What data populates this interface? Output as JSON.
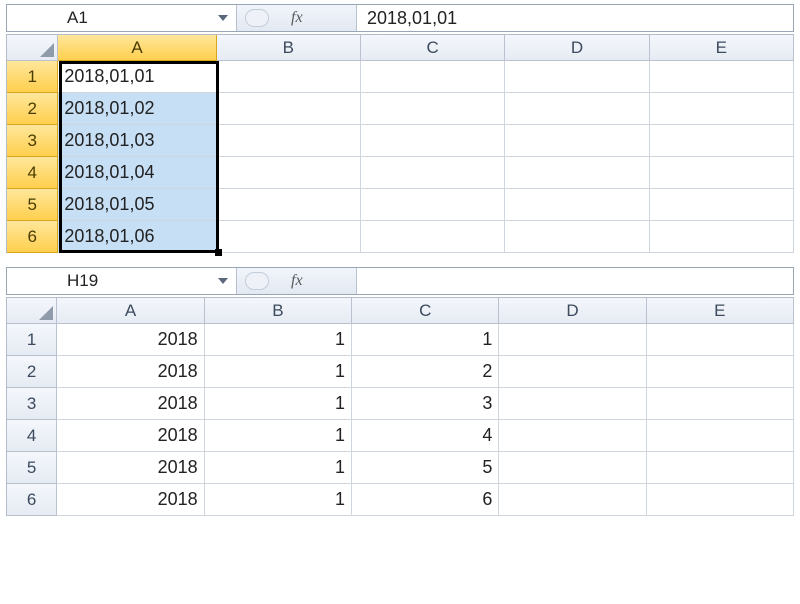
{
  "top_sheet": {
    "namebox": "A1",
    "formula_value": "2018,01,01",
    "columns": [
      "A",
      "B",
      "C",
      "D",
      "E"
    ],
    "row_numbers": [
      "1",
      "2",
      "3",
      "4",
      "5",
      "6"
    ],
    "cells": {
      "A": [
        "2018,01,01",
        "2018,01,02",
        "2018,01,03",
        "2018,01,04",
        "2018,01,05",
        "2018,01,06"
      ],
      "B": [
        "",
        "",
        "",
        "",
        "",
        ""
      ],
      "C": [
        "",
        "",
        "",
        "",
        "",
        ""
      ],
      "D": [
        "",
        "",
        "",
        "",
        "",
        ""
      ],
      "E": [
        "",
        "",
        "",
        "",
        "",
        ""
      ]
    },
    "selected_range": "A1:A6",
    "active_cell": "A1"
  },
  "bottom_sheet": {
    "namebox": "H19",
    "formula_value": "",
    "columns": [
      "A",
      "B",
      "C",
      "D",
      "E"
    ],
    "row_numbers": [
      "1",
      "2",
      "3",
      "4",
      "5",
      "6"
    ],
    "cells": {
      "A": [
        "2018",
        "2018",
        "2018",
        "2018",
        "2018",
        "2018"
      ],
      "B": [
        "1",
        "1",
        "1",
        "1",
        "1",
        "1"
      ],
      "C": [
        "1",
        "2",
        "3",
        "4",
        "5",
        "6"
      ],
      "D": [
        "",
        "",
        "",
        "",
        "",
        ""
      ],
      "E": [
        "",
        "",
        "",
        "",
        "",
        ""
      ]
    }
  },
  "fx_label": "fx"
}
